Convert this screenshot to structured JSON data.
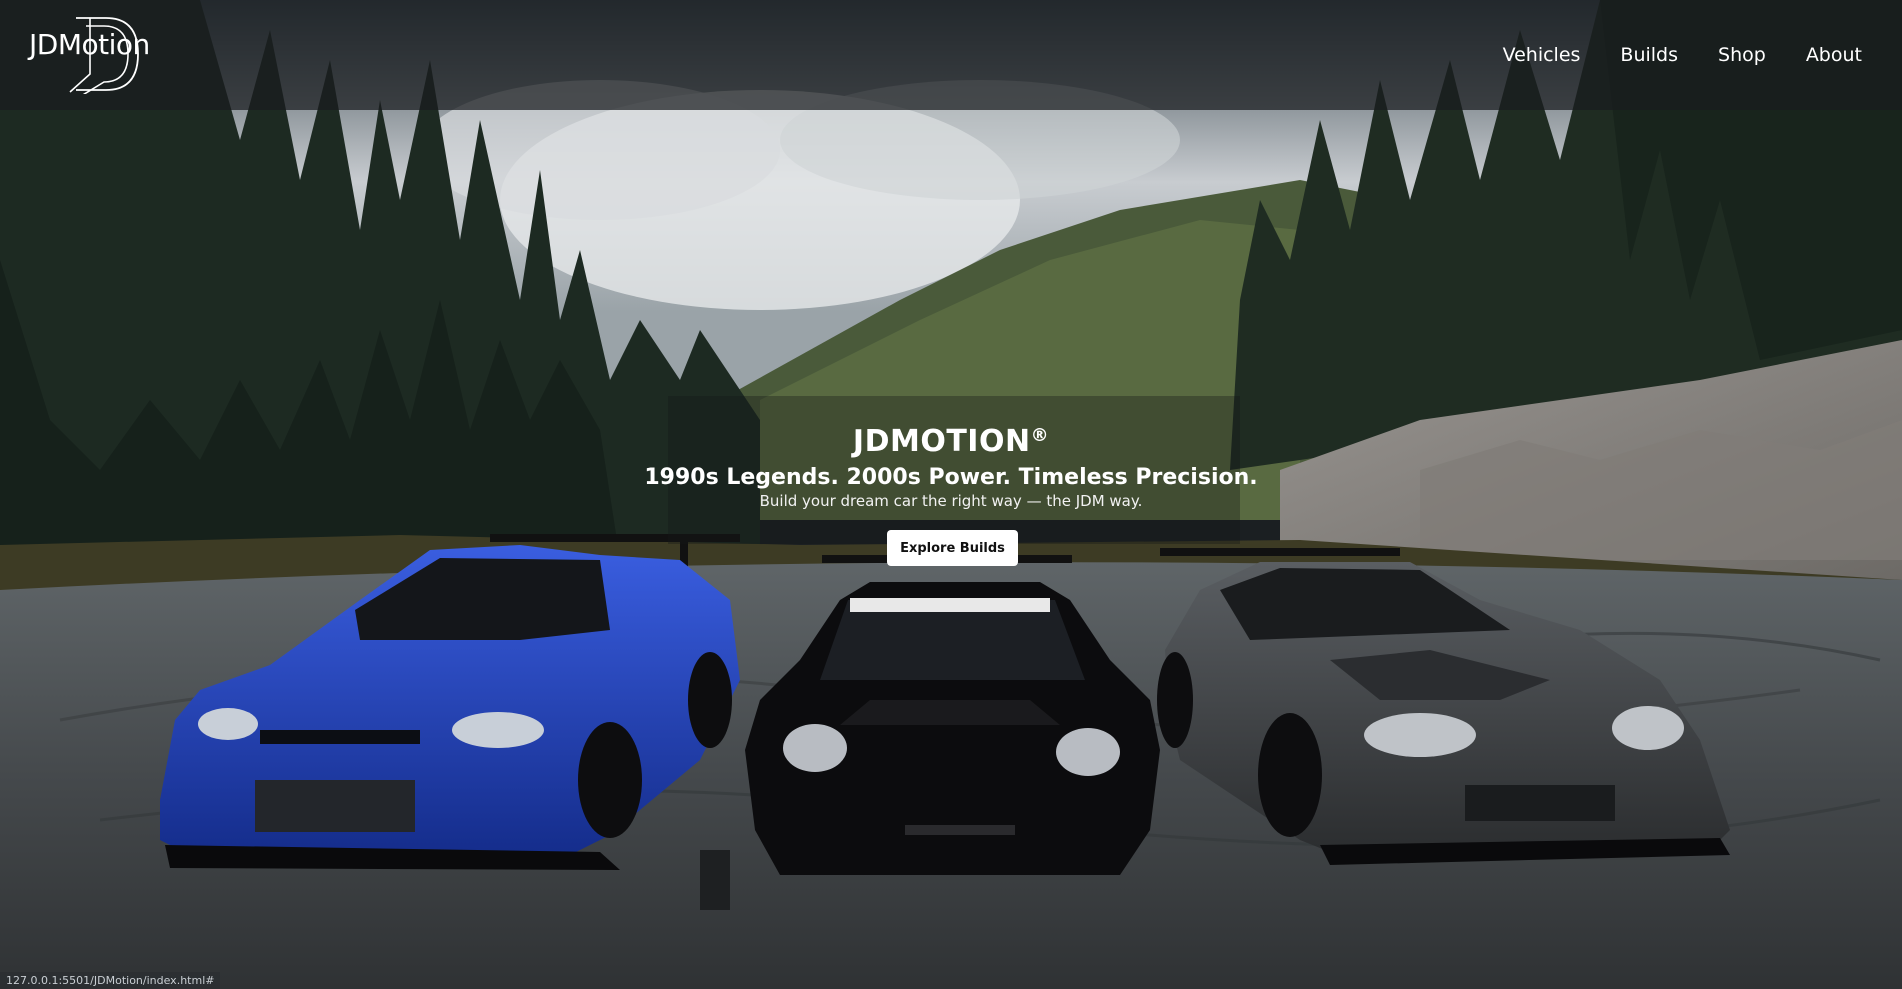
{
  "brand": {
    "logo_text": "JDMotion"
  },
  "nav": {
    "items": [
      {
        "label": "Vehicles"
      },
      {
        "label": "Builds"
      },
      {
        "label": "Shop"
      },
      {
        "label": "About"
      }
    ]
  },
  "hero": {
    "title": "JDMOTION",
    "title_mark": "®",
    "subtitle": "1990s Legends. 2000s Power. Timeless Precision.",
    "tagline": "Build your dream car the right way — the JDM way.",
    "cta_label": "Explore Builds"
  },
  "status": {
    "url": "127.0.0.1:5501/JDMotion/index.html#"
  },
  "colors": {
    "navbar_bg": "#191c1e",
    "cta_bg": "#ffffff",
    "car_left": "#1e3fb8",
    "car_center": "#0c0c0e",
    "car_right": "#3a3d40"
  }
}
